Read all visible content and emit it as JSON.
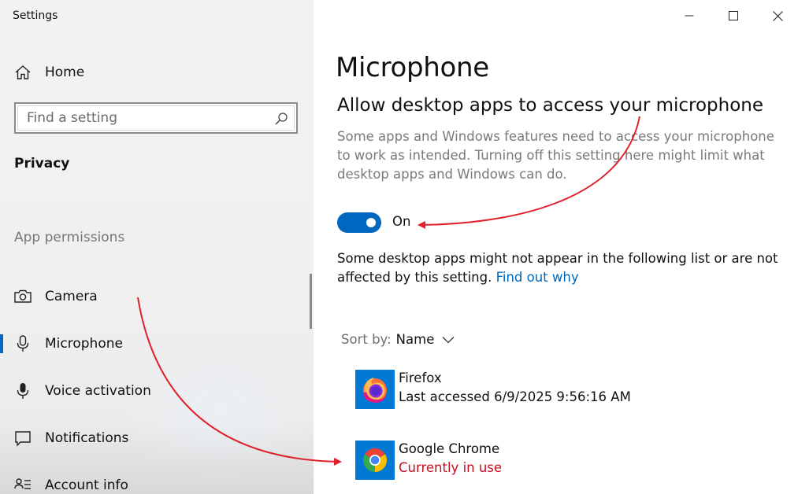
{
  "window": {
    "title": "Settings",
    "controls": {
      "minimize": "minimize-icon",
      "maximize": "maximize-icon",
      "close": "close-icon"
    }
  },
  "sidebar": {
    "home_label": "Home",
    "search": {
      "placeholder": "Find a setting",
      "value": ""
    },
    "section_title": "Privacy",
    "group_label": "App permissions",
    "items": [
      {
        "label": "Camera",
        "icon": "camera-icon",
        "active": false
      },
      {
        "label": "Microphone",
        "icon": "microphone-icon",
        "active": true
      },
      {
        "label": "Voice activation",
        "icon": "voice-activation-icon",
        "active": false
      },
      {
        "label": "Notifications",
        "icon": "notifications-icon",
        "active": false
      },
      {
        "label": "Account info",
        "icon": "account-info-icon",
        "active": false
      }
    ]
  },
  "main": {
    "page_title": "Microphone",
    "section_heading": "Allow desktop apps to access your microphone",
    "description": "Some apps and Windows features need to access your microphone to work as intended. Turning off this setting here might limit what desktop apps and Windows can do.",
    "toggle": {
      "state": "On",
      "on": true
    },
    "note": "Some desktop apps might not appear in the following list or are not affected by this setting.",
    "note_link": "Find out why",
    "sort": {
      "label": "Sort by:",
      "value": "Name"
    },
    "apps": [
      {
        "name": "Firefox",
        "status": "Last accessed 6/9/2025 9:56:16 AM",
        "icon": "firefox-icon",
        "in_use": false
      },
      {
        "name": "Google Chrome",
        "status": "Currently in use",
        "icon": "chrome-icon",
        "in_use": true
      }
    ]
  },
  "colors": {
    "accent": "#0067c0",
    "link": "#0067b8",
    "in_use": "#c50f1f",
    "annotation_arrow": "#e0202a"
  }
}
